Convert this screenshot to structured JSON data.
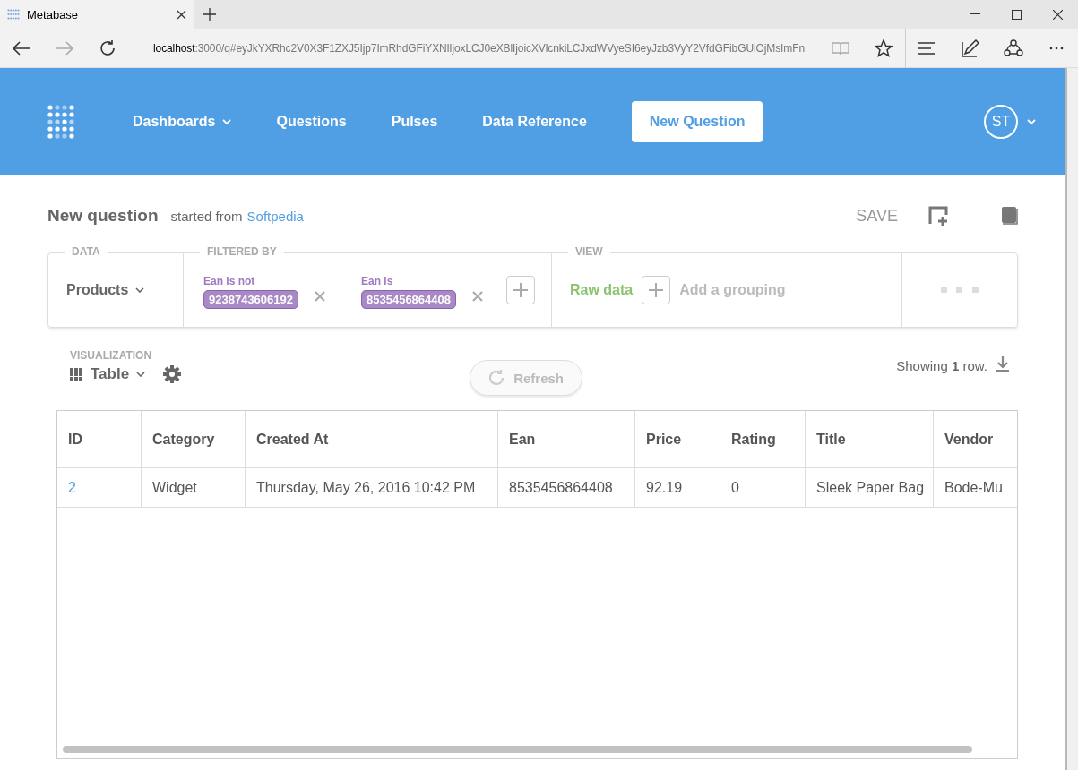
{
  "browser": {
    "tab_title": "Metabase",
    "url_host": "localhost",
    "url_rest": ":3000/q#eyJkYXRhc2V0X3F1ZXJ5Ijp7ImRhdGFiYXNlIjoxLCJ0eXBlIjoicXVlcnkiLCJxdWVyeSI6eyJzb3VyY2VfdGFibGUiOjMsImFn"
  },
  "nav": {
    "items": [
      {
        "label": "Dashboards",
        "dropdown": true
      },
      {
        "label": "Questions",
        "dropdown": false
      },
      {
        "label": "Pulses",
        "dropdown": false
      },
      {
        "label": "Data Reference",
        "dropdown": false
      }
    ],
    "new_question": "New Question",
    "avatar": "ST"
  },
  "question": {
    "title": "New question",
    "started_from": "started from",
    "source": "Softpedia",
    "save": "SAVE"
  },
  "query": {
    "data_label": "DATA",
    "table": "Products",
    "filter_label": "FILTERED BY",
    "filters": [
      {
        "label": "Ean is not",
        "value": "9238743606192"
      },
      {
        "label": "Ean is",
        "value": "8535456864408"
      }
    ],
    "view_label": "VIEW",
    "view": "Raw data",
    "grouping_placeholder": "Add a grouping"
  },
  "visualization": {
    "label": "VISUALIZATION",
    "type": "Table",
    "refresh": "Refresh",
    "showing": "Showing **1** row."
  },
  "table": {
    "columns": [
      "ID",
      "Category",
      "Created At",
      "Ean",
      "Price",
      "Rating",
      "Title",
      "Vendor"
    ],
    "rows": [
      [
        "2",
        "Widget",
        "Thursday, May 26, 2016 10:42 PM",
        "8535456864408",
        "92.19",
        "0",
        "Sleek Paper Bag",
        "Bode-Mu"
      ]
    ]
  }
}
